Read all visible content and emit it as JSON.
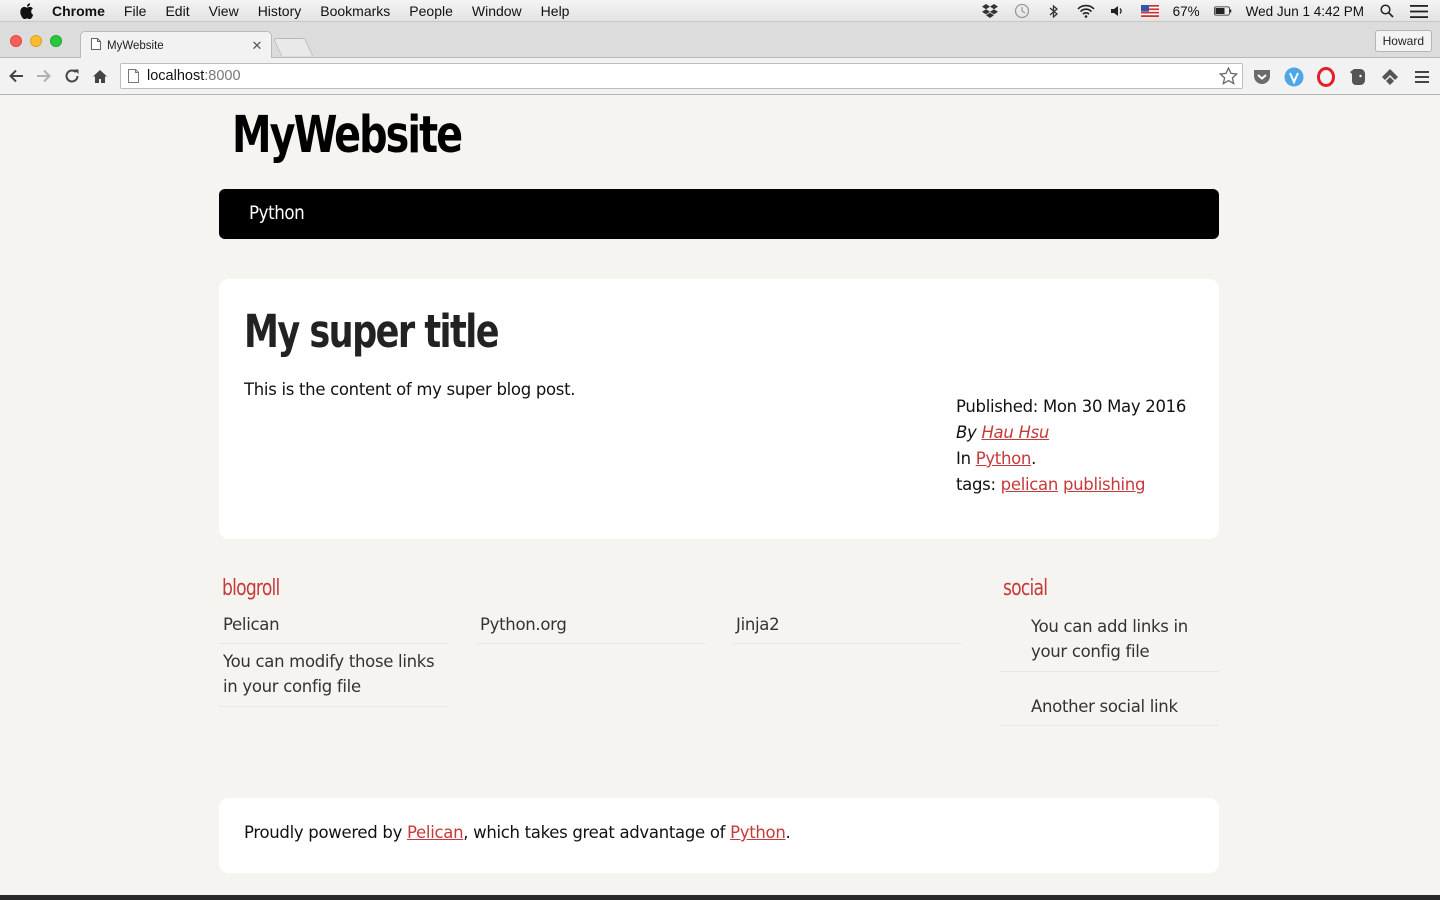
{
  "os_menubar": {
    "app_name": "Chrome",
    "menus": [
      "File",
      "Edit",
      "View",
      "History",
      "Bookmarks",
      "People",
      "Window",
      "Help"
    ],
    "battery": "67%",
    "clock": "Wed Jun 1  4:42 PM"
  },
  "browser": {
    "tab_title": "MyWebsite",
    "profile_name": "Howard",
    "url_host": "localhost",
    "url_port": ":8000"
  },
  "site": {
    "title": "MyWebsite",
    "nav": [
      "Python"
    ]
  },
  "article": {
    "title": "My super title",
    "content": "This is the content of my super blog post.",
    "published": "Published: Mon 30 May 2016",
    "by_prefix": "By",
    "author": "Hau Hsu",
    "category_prefix": "In",
    "category": "Python",
    "tags_prefix": "tags:",
    "tags": [
      "pelican",
      "publishing"
    ]
  },
  "blogroll": {
    "heading": "blogroll",
    "links": [
      "Pelican",
      "Python.org",
      "Jinja2",
      "You can modify those links in your config file"
    ]
  },
  "social": {
    "heading": "social",
    "links": [
      "You can add links in your config file",
      "Another social link"
    ]
  },
  "footer": {
    "prefix": "Proudly powered by",
    "link1": "Pelican",
    "middle": ", which takes great advantage of",
    "link2": "Python",
    "suffix": "."
  },
  "colors": {
    "accent": "#c63a3a",
    "navbar": "#000000",
    "page_bg": "#f5f4f0"
  }
}
